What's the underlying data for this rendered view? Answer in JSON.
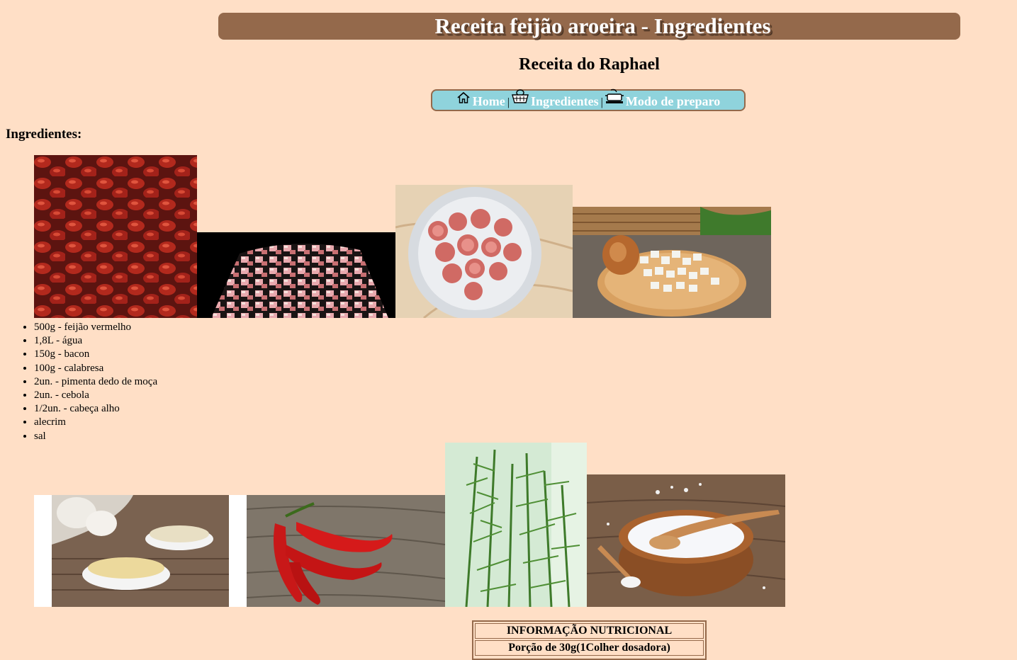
{
  "header": {
    "title": "Receita feijão aroeira - Ingredientes",
    "subtitle": "Receita do Raphael"
  },
  "nav": {
    "items": [
      {
        "label": "Home",
        "icon": "home-icon"
      },
      {
        "label": "Ingredientes",
        "icon": "basket-icon"
      },
      {
        "label": "Modo de preparo",
        "icon": "cooking-pot-icon"
      }
    ],
    "separator": "|"
  },
  "main": {
    "section_heading": "Ingredientes:",
    "ingredients": [
      "500g - feijão vermelho",
      "1,8L - água",
      "150g - bacon",
      "100g - calabresa",
      "2un. - pimenta dedo de moça",
      "2un. - cebola",
      "1/2un. - cabeça alho",
      "alecrim",
      "sal"
    ],
    "images_top": [
      "red-beans-image",
      "diced-bacon-image",
      "sliced-calabresa-image",
      "diced-onion-image"
    ],
    "images_bottom": [
      "garlic-image",
      "chili-peppers-image",
      "rosemary-image",
      "salt-bowl-image"
    ]
  },
  "nutrition": {
    "title": "INFORMAÇÃO NUTRICIONAL",
    "portion": "Porção de 30g(1Colher dosadora)"
  },
  "colors": {
    "background": "#ffdfc6",
    "brown": "#94694b",
    "nav_bg": "#8fd3dc"
  }
}
